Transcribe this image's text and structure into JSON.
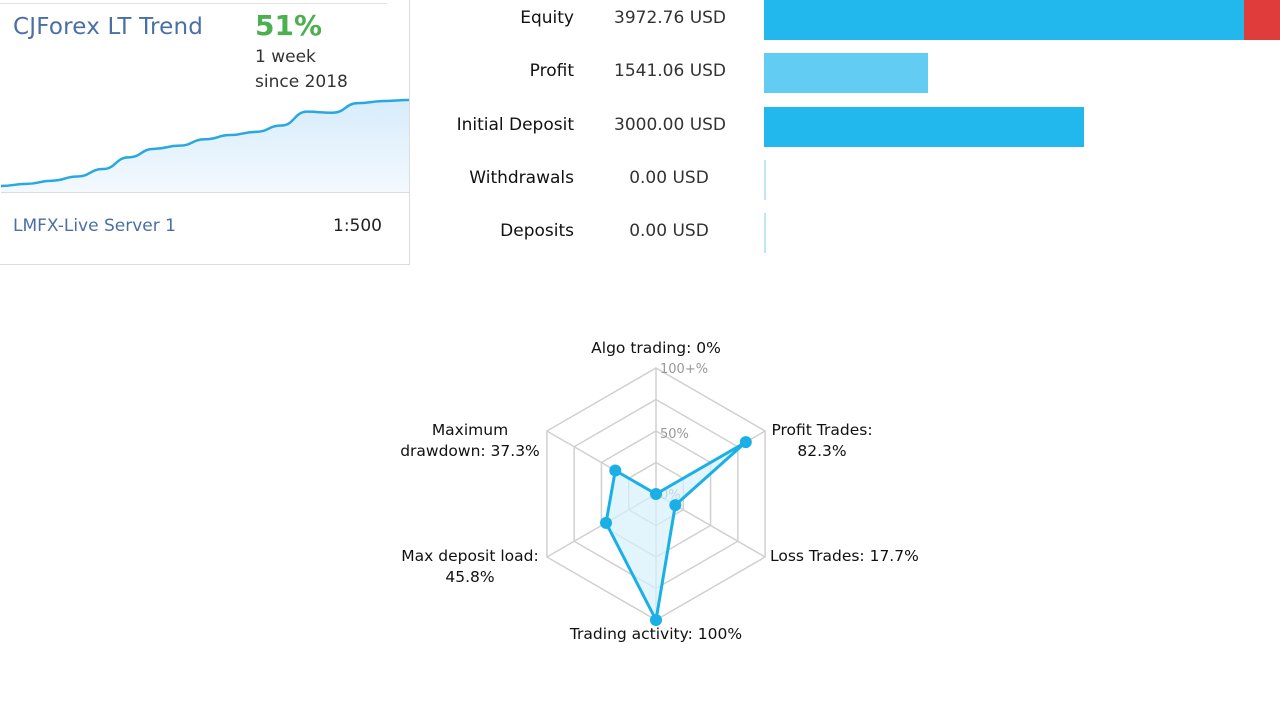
{
  "signal_card": {
    "title": "CJForex LT Trend",
    "growth": "51%",
    "period": "1 week",
    "since": "since 2018",
    "server": "LMFX-Live Server 1",
    "leverage": "1:500",
    "growth_color": "#4caf50",
    "title_color": "#4a6fa5",
    "sparkline": [
      0,
      2,
      5,
      9,
      16,
      27,
      35,
      38,
      44,
      48,
      51,
      57,
      70,
      69,
      78,
      80,
      81
    ]
  },
  "balance": {
    "max_scale": 3972.76,
    "rows": [
      {
        "label": "Equity",
        "value": "3972.76 USD",
        "amount": 3972.76,
        "color": "#22b8ee",
        "overflow_color": "#e03c3c",
        "overflow_fraction": 0.07
      },
      {
        "label": "Profit",
        "value": "1541.06 USD",
        "amount": 1541.06,
        "color": "#62ccf3"
      },
      {
        "label": "Initial Deposit",
        "value": "3000.00 USD",
        "amount": 3000.0,
        "color": "#22b8ee"
      },
      {
        "label": "Withdrawals",
        "value": "0.00 USD",
        "amount": 0,
        "color": "#bfe6f5"
      },
      {
        "label": "Deposits",
        "value": "0.00 USD",
        "amount": 0,
        "color": "#bfe6f5"
      }
    ]
  },
  "radar": {
    "ring_labels": [
      "0%",
      "50%",
      "100+%"
    ],
    "axes": [
      {
        "name": "Algo trading",
        "text_lines": [
          "Algo trading: 0%"
        ],
        "value": 0
      },
      {
        "name": "Profit Trades",
        "text_lines": [
          "Profit Trades:",
          "82.3%"
        ],
        "value": 82.3
      },
      {
        "name": "Loss Trades",
        "text_lines": [
          "Loss Trades: 17.7%"
        ],
        "value": 17.7
      },
      {
        "name": "Trading activity",
        "text_lines": [
          "Trading activity: 100%"
        ],
        "value": 100
      },
      {
        "name": "Max deposit load",
        "text_lines": [
          "Max deposit load:",
          "45.8%"
        ],
        "value": 45.8
      },
      {
        "name": "Maximum drawdown",
        "text_lines": [
          "Maximum",
          "drawdown: 37.3%"
        ],
        "value": 37.3
      }
    ],
    "line_color": "#1ab0e6",
    "fill_color": "#d6f0fb",
    "grid_color": "#d0d0d0"
  }
}
